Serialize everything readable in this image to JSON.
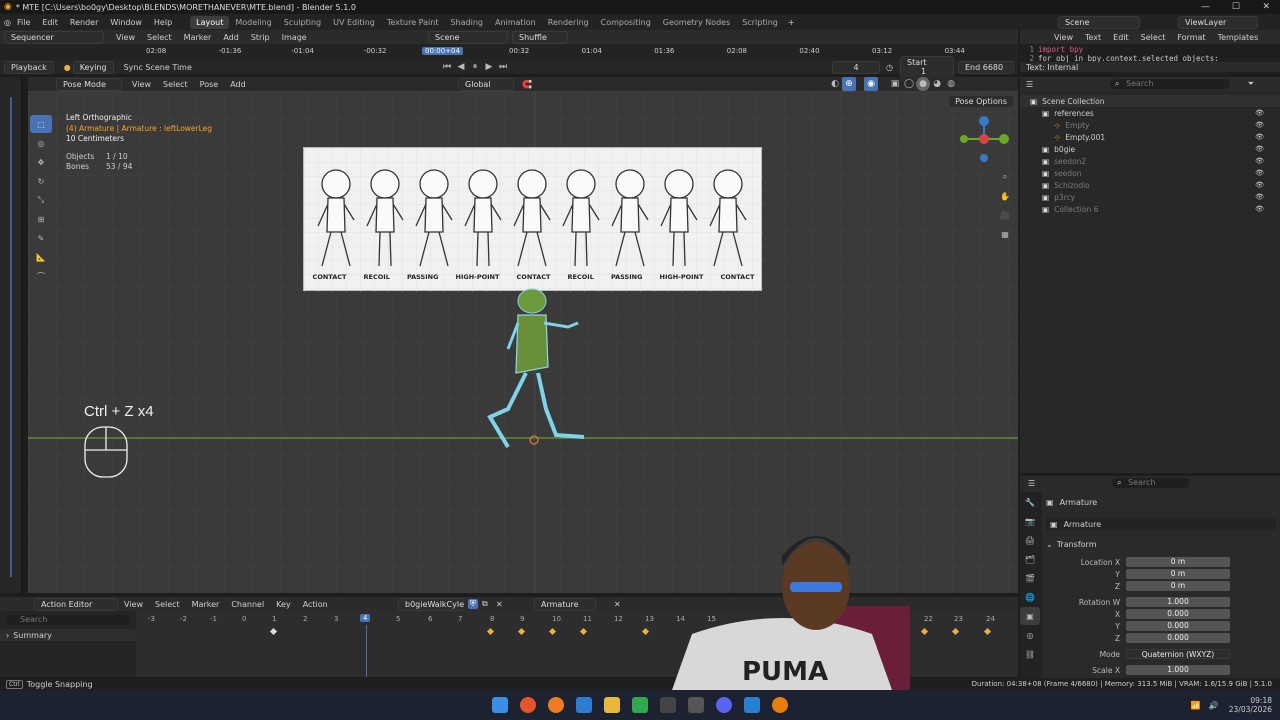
{
  "title_bar": {
    "text": "* MTE [C:\\Users\\bo0gy\\Desktop\\BLENDS\\MORETHANEVER\\MTE.blend] - Blender 5.1.0"
  },
  "top_menu": [
    "File",
    "Edit",
    "Render",
    "Window",
    "Help"
  ],
  "workspaces": [
    "Layout",
    "Modeling",
    "Sculpting",
    "UV Editing",
    "Texture Paint",
    "Shading",
    "Animation",
    "Rendering",
    "Compositing",
    "Geometry Nodes",
    "Scripting"
  ],
  "scene": {
    "scene_name": "Scene",
    "view_layer": "ViewLayer"
  },
  "sequencer": {
    "editor": "Sequencer",
    "menu": [
      "View",
      "Select",
      "Marker",
      "Add",
      "Strip",
      "Image"
    ],
    "scene": "Scene",
    "shuffle": "Shuffle",
    "timecodes": [
      "02:08",
      "-01:36",
      "-01:04",
      "-00:32",
      "00:00+04",
      "00:32",
      "01:04",
      "01:36",
      "02:08",
      "02:40",
      "03:12",
      "03:44"
    ]
  },
  "playback_bar": {
    "playback": "Playback",
    "keying": "Keying",
    "sync": "Sync Scene Time",
    "current_frame": "4",
    "start_label": "Start",
    "start_value": "1",
    "end_label": "End",
    "end_value": "6680"
  },
  "text_editor": {
    "menu": [
      "View",
      "Text",
      "Edit",
      "Select",
      "Format",
      "Templates"
    ],
    "line1_num": "1",
    "line1_code": "import bpy",
    "line2_num": "2",
    "line2_code": "for obj in bpy.context.selected_objects:",
    "status": "Text: Internal"
  },
  "viewport": {
    "mode": "Pose Mode",
    "menu": [
      "View",
      "Select",
      "Pose",
      "Add"
    ],
    "orientation": "Global",
    "pose_options": "Pose Options",
    "info_view": "Left Orthographic",
    "info_armature": "(4) Armature | Armature : leftLowerLeg",
    "info_scale": "10 Centimeters",
    "objects_label": "Objects",
    "objects_value": "1 / 10",
    "bones_label": "Bones",
    "bones_value": "53 / 94",
    "shortcut_text": "Ctrl + Z x4",
    "reference_labels": [
      "CONTACT",
      "RECOIL",
      "PASSING",
      "HIGH-POINT",
      "CONTACT",
      "RECOIL",
      "PASSING",
      "HIGH-POINT",
      "CONTACT"
    ]
  },
  "outliner": {
    "search_placeholder": "Search",
    "items": [
      {
        "name": "Scene Collection",
        "depth": 0
      },
      {
        "name": "references",
        "depth": 1
      },
      {
        "name": "Empty",
        "depth": 2
      },
      {
        "name": "Empty.001",
        "depth": 2
      },
      {
        "name": "b0gie",
        "depth": 1
      },
      {
        "name": "seedon2",
        "depth": 1
      },
      {
        "name": "seedon",
        "depth": 1
      },
      {
        "name": "Schizodio",
        "depth": 1
      },
      {
        "name": "p3rcy",
        "depth": 1
      },
      {
        "name": "Collection 6",
        "depth": 1
      }
    ]
  },
  "properties": {
    "search_placeholder": "Search",
    "object_name": "Armature",
    "data_name": "Armature",
    "transform_label": "Transform",
    "location_label": "Location X",
    "loc_x": "0 m",
    "y_label": "Y",
    "loc_y": "0 m",
    "z_label": "Z",
    "loc_z": "0 m",
    "rotation_label": "Rotation W",
    "rot_w": "1.000",
    "x_label": "X",
    "rot_x": "0.000",
    "rot_y": "0.000",
    "rot_z": "0.000",
    "mode_label": "Mode",
    "mode_value": "Quaternion (WXYZ)",
    "scale_label": "Scale X",
    "scale_x": "1.000"
  },
  "action_editor": {
    "editor": "Action Editor",
    "menu": [
      "View",
      "Select",
      "Marker",
      "Channel",
      "Key",
      "Action"
    ],
    "action_name": "b0gieWalkCyle",
    "object_name": "Armature",
    "search_placeholder": "Search",
    "summary": "Summary",
    "frame_ticks": [
      "-3",
      "-2",
      "-1",
      "0",
      "1",
      "2",
      "3",
      "4",
      "5",
      "6",
      "7",
      "8",
      "9",
      "10",
      "11",
      "12",
      "13",
      "14",
      "15",
      "22",
      "23",
      "24"
    ],
    "current_frame": "4"
  },
  "status_bar": {
    "left": "Toggle Snapping",
    "right": "Duration: 04:38+08 (Frame 4/6680) | Memory: 313.5 MiB | VRAM: 1.6/15.9 GiB | 5.1.0"
  },
  "taskbar": {
    "time": "09:18",
    "date": "23/03/2026"
  },
  "colors": {
    "accent": "#4772b3",
    "active_orange": "#f5a623",
    "keyframe": "#e9b23a",
    "ground_line": "#6a9a2a"
  }
}
